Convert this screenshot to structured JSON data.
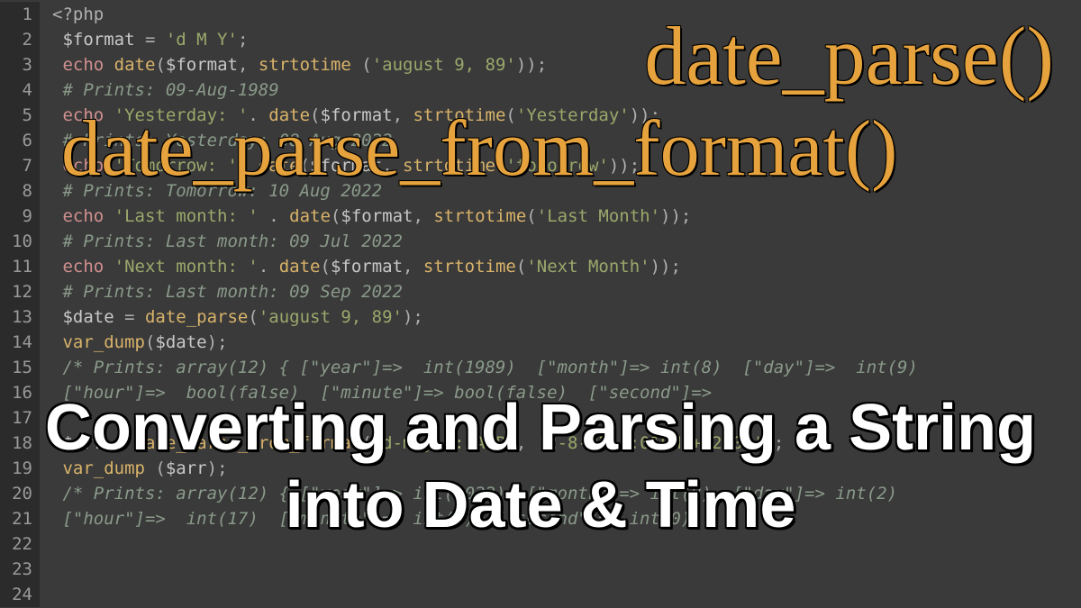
{
  "gutter": [
    "1",
    "2",
    "3",
    "4",
    "5",
    "6",
    "7",
    "8",
    "9",
    "10",
    "11",
    "12",
    "13",
    "14",
    "15",
    "16",
    "17",
    "18",
    "19",
    "20",
    "21",
    "22",
    "23",
    "24"
  ],
  "overlays": {
    "title1": "date_parse()",
    "title2": "date_parse_from_format()",
    "title3": "Converting and Parsing a String into Date & Time"
  },
  "code": {
    "l1": {
      "a": "<?php"
    },
    "l2": {
      "a": " ",
      "b": "$format",
      "c": " = ",
      "d": "'d M Y'",
      "e": ";"
    },
    "l3": {
      "a": " ",
      "b": "echo",
      "c": " ",
      "d": "date",
      "e": "(",
      "f": "$format",
      "g": ", ",
      "h": "strtotime",
      "i": " (",
      "j": "'august 9, 89'",
      "k": "));"
    },
    "l4": {
      "a": " ",
      "b": "# Prints: 09-Aug-1989"
    },
    "l5": {
      "a": " ",
      "b": "echo",
      "c": " ",
      "d": "'Yesterday: '",
      "e": ". ",
      "f": "date",
      "g": "(",
      "h": "$format",
      "i": ", ",
      "j": "strtotime",
      "k": "(",
      "l": "'Yesterday'",
      "m": "));"
    },
    "l6": {
      "a": " ",
      "b": "# Prints: Yesterday: 08 Aug 2022"
    },
    "l7": {
      "a": " ",
      "b": "echo",
      "c": " ",
      "d": "'Tomorrow: '",
      "e": ". ",
      "f": "date",
      "g": "(",
      "h": "$format",
      "i": ", ",
      "j": "strtotime",
      "k": "(",
      "l": "'tomorrow'",
      "m": "));"
    },
    "l8": {
      "a": " ",
      "b": "# Prints: Tomorrow: 10 Aug 2022"
    },
    "l9": {
      "a": " ",
      "b": "echo",
      "c": " ",
      "d": "'Last month: '",
      "e": " . ",
      "f": "date",
      "g": "(",
      "h": "$format",
      "i": ", ",
      "j": "strtotime",
      "k": "(",
      "l": "'Last Month'",
      "m": "));"
    },
    "l10": {
      "a": " ",
      "b": "# Prints: Last month: 09 Jul 2022"
    },
    "l11": {
      "a": " ",
      "b": "echo",
      "c": " ",
      "d": "'Next month: '",
      "e": ". ",
      "f": "date",
      "g": "(",
      "h": "$format",
      "i": ", ",
      "j": "strtotime",
      "k": "(",
      "l": "'Next Month'",
      "m": "));"
    },
    "l12": {
      "a": " ",
      "b": "# Prints: Last month: 09 Sep 2022"
    },
    "l13": {
      "a": " ",
      "b": "$date",
      "c": " = ",
      "d": "date_parse",
      "e": "(",
      "f": "'august 9, 89'",
      "g": ");"
    },
    "l14": {
      "a": " ",
      "b": "var_dump",
      "c": "(",
      "d": "$date",
      "e": ");"
    },
    "l15": {
      "a": " ",
      "b": "/* Prints: array(12) { [\"year\"]=>  int(1989)  [\"month\"]=> int(8)  [\"day\"]=>  int(9)"
    },
    "l16": {
      "a": " ",
      "b": "[\"hour\"]=>  bool(false)  [\"minute\"]=> bool(false)  [\"second\"]=>"
    },
    "l17": {
      "a": " "
    },
    "l18": {
      "a": " ",
      "b": "$arr",
      "c": " = ",
      "d": "date_parse_from_format",
      "e": "(",
      "f": "'d-m-y h:iA P'",
      "g": ", ",
      "h": "'2-8-22 5:01PM +02:00'",
      "i": ");"
    },
    "l19": {
      "a": " ",
      "b": "var_dump",
      "c": " (",
      "d": "$arr",
      "e": ");"
    },
    "l20": {
      "a": " ",
      "b": "/* Prints: array(12) { [\"year\"]=> int(2022)  [\"month\"]=> int(8)  [\"day\"]=> int(2)"
    },
    "l21": {
      "a": " ",
      "b": "[\"hour\"]=>  int(17)  [\"minute\"]=> int(1)  [\"second\"]=> int(0) ..."
    }
  }
}
